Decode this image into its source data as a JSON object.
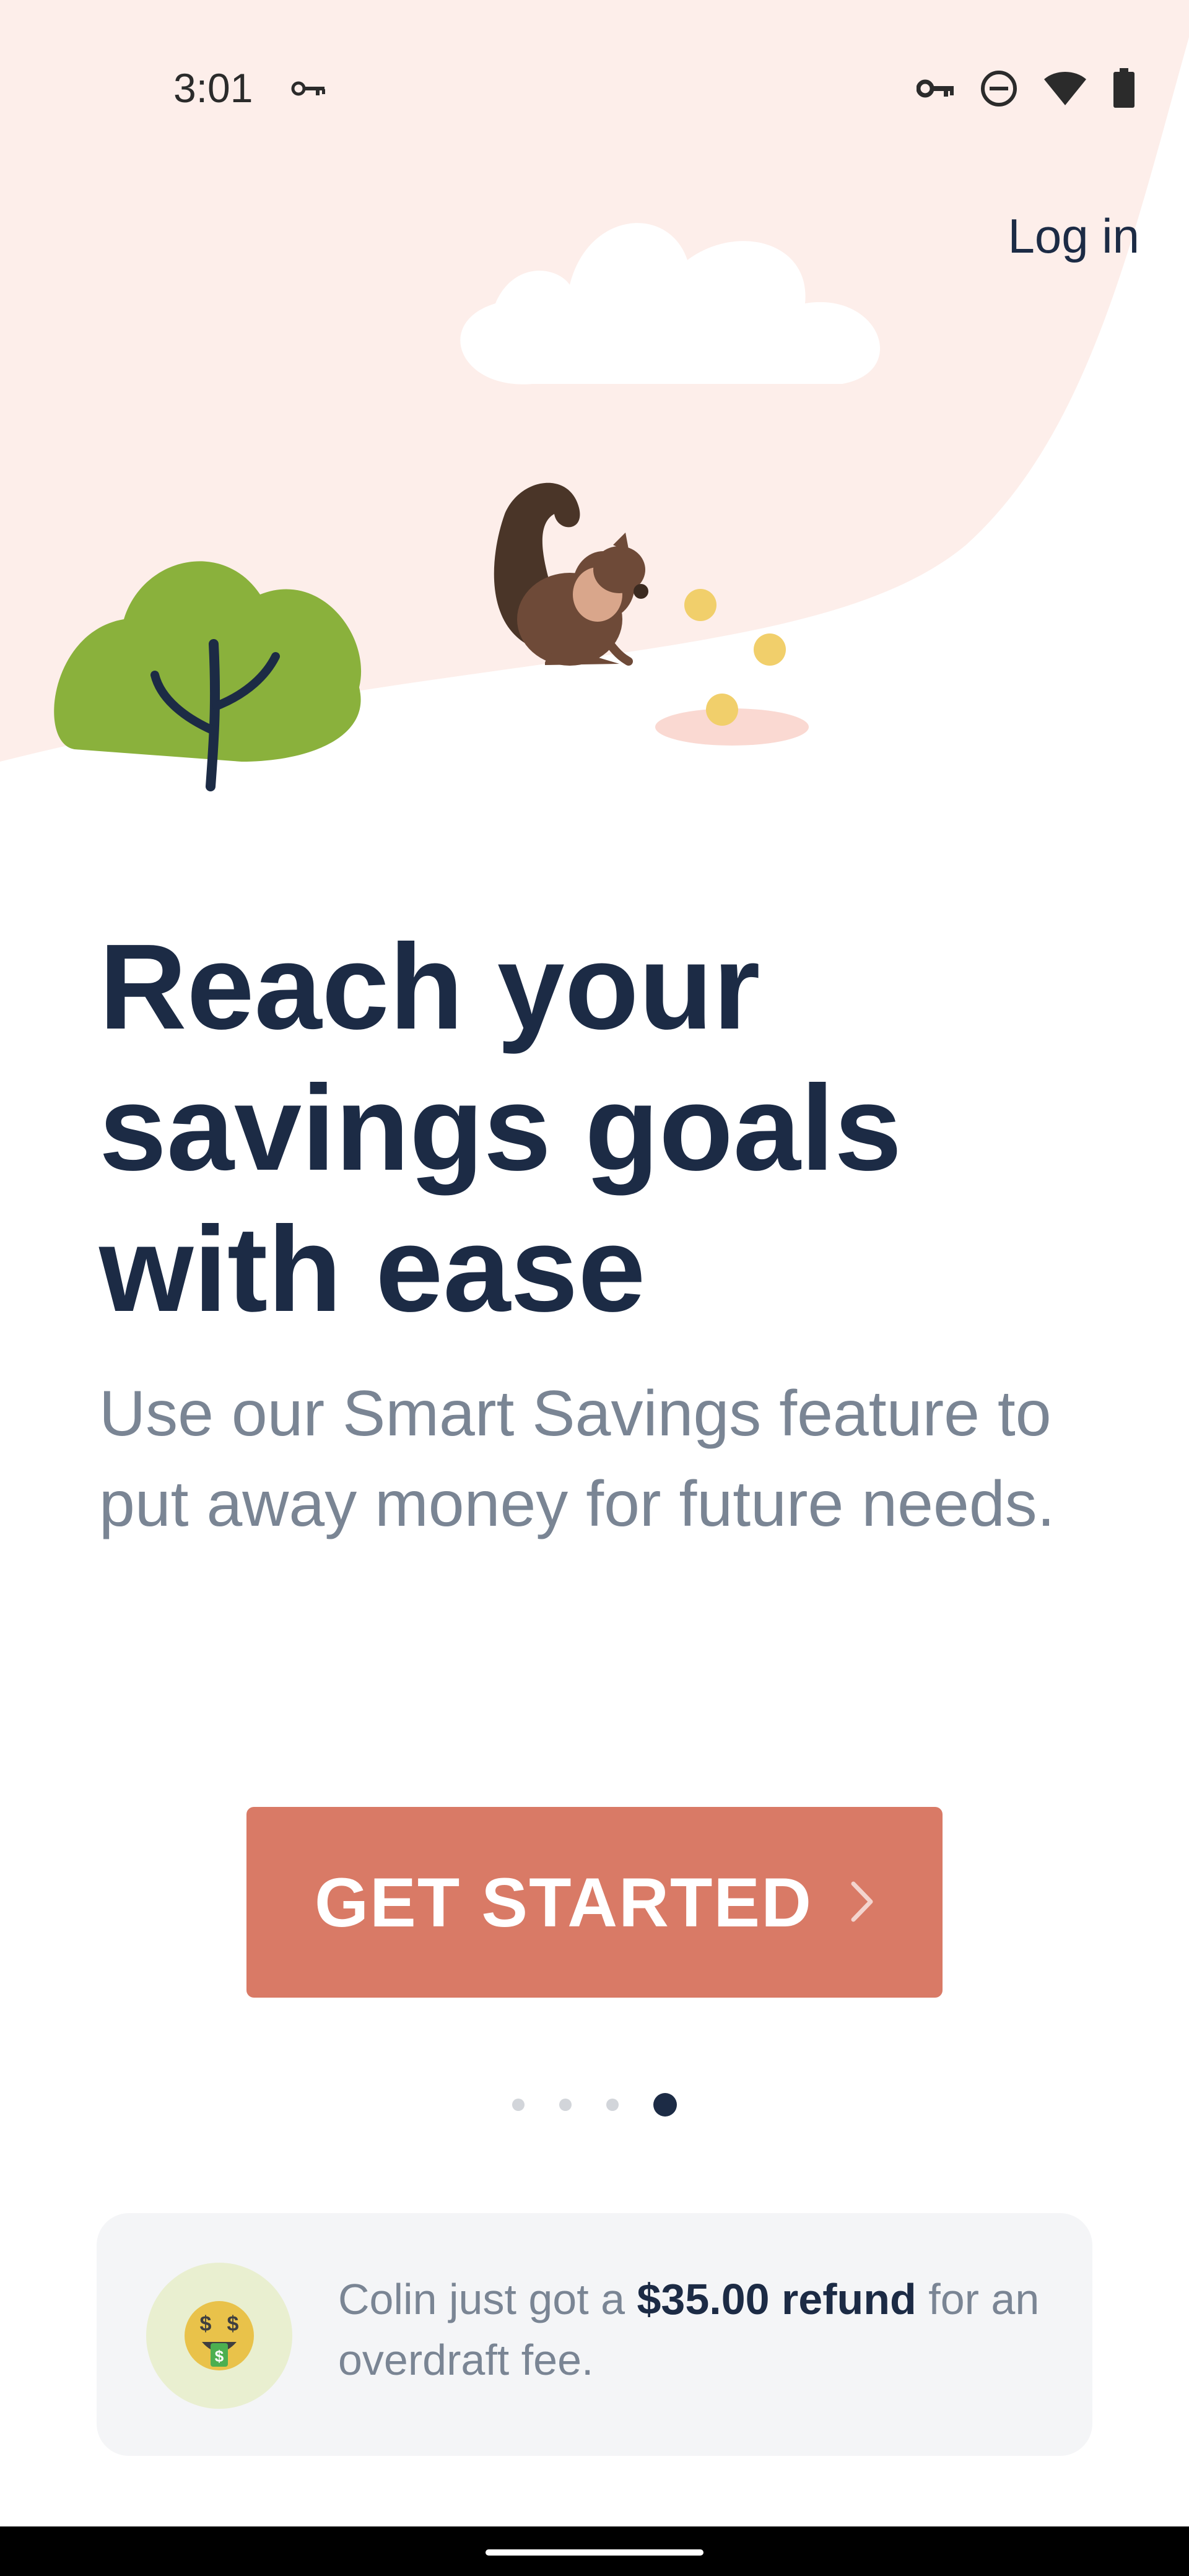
{
  "status_bar": {
    "time": "3:01",
    "icons": [
      "vpn-key-icon",
      "do-not-disturb-icon",
      "wifi-icon",
      "battery-icon"
    ]
  },
  "header": {
    "login_label": "Log in"
  },
  "hero": {
    "illustration": [
      "cloud",
      "squirrel",
      "tree",
      "coins"
    ]
  },
  "main": {
    "headline_lines": [
      "Reach your",
      "savings goals",
      "with ease"
    ],
    "subtext": "Use our Smart Savings feature to put away money for future needs.",
    "cta_label": "GET STARTED",
    "cta_icon": "chevron-right-icon"
  },
  "pager": {
    "total": 4,
    "active": 4
  },
  "toast": {
    "avatar_icon": "money-face-emoji-icon",
    "text_before": "Colin just got a ",
    "text_bold": "$35.00 refund",
    "text_after": " for an overdraft fee."
  },
  "colors": {
    "accent": "#d97a66",
    "heading": "#1c2b45",
    "body_text": "#7a8594",
    "hero_bg": "#fdeeea",
    "tree": "#8ab13c"
  }
}
